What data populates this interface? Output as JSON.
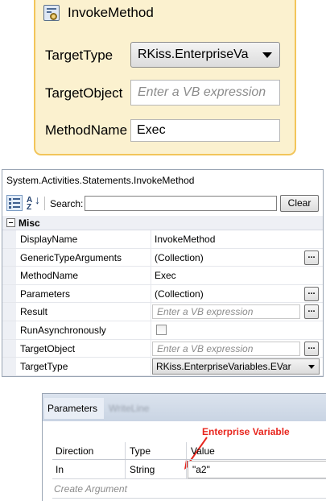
{
  "activity": {
    "icon": "invoke-method-icon",
    "title": "InvokeMethod",
    "target_type_label": "TargetType",
    "target_type_value": "RKiss.EnterpriseVa",
    "target_object_label": "TargetObject",
    "target_object_placeholder": "Enter a VB expression",
    "method_name_label": "MethodName",
    "method_name_value": "Exec"
  },
  "property_grid": {
    "title": "System.Activities.Statements.InvokeMethod",
    "search_label": "Search:",
    "search_value": "",
    "clear_label": "Clear",
    "category": "Misc",
    "rows": [
      {
        "name": "DisplayName",
        "value": "InvokeMethod"
      },
      {
        "name": "GenericTypeArguments",
        "value": "(Collection)"
      },
      {
        "name": "MethodName",
        "value": "Exec"
      },
      {
        "name": "Parameters",
        "value": "(Collection)"
      },
      {
        "name": "Result",
        "placeholder": "Enter a VB expression"
      },
      {
        "name": "RunAsynchronously",
        "checked": false
      },
      {
        "name": "TargetObject",
        "placeholder": "Enter a VB expression"
      },
      {
        "name": "TargetType",
        "value": "RKiss.EnterpriseVariables.EVar"
      }
    ],
    "ellipsis": "..."
  },
  "parameters": {
    "tab_label": "Parameters",
    "blurred_tab": "WriteLine",
    "annotation": "Enterprise Variable",
    "columns": [
      "Direction",
      "Type",
      "Value"
    ],
    "rows": [
      {
        "direction": "In",
        "type": "String",
        "value": "\"a2\""
      }
    ],
    "create_argument": "Create Argument"
  },
  "colors": {
    "activity_fill": "#fbf1cf",
    "activity_border": "#f2c55a",
    "annotation_red": "#e8251d"
  }
}
